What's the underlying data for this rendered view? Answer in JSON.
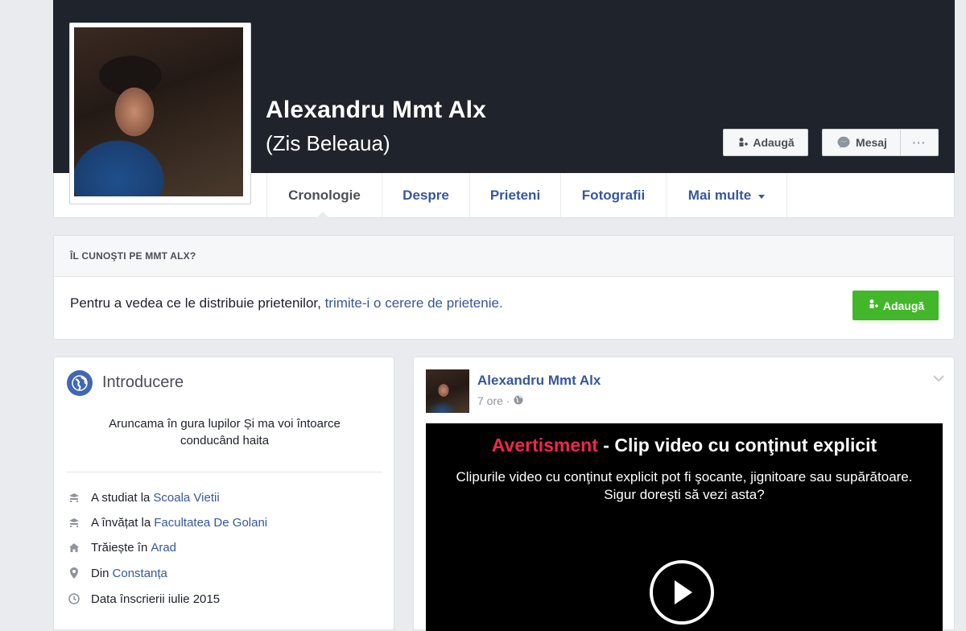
{
  "profile": {
    "name": "Alexandru Mmt Alx",
    "alt_name": "(Zis Beleaua)"
  },
  "header_buttons": {
    "add_friend": "Adaugă",
    "message": "Mesaj",
    "more": "···"
  },
  "tabs": [
    {
      "label": "Cronologie",
      "active": true
    },
    {
      "label": "Despre"
    },
    {
      "label": "Prieteni"
    },
    {
      "label": "Fotografii"
    },
    {
      "label": "Mai multe"
    }
  ],
  "know_card": {
    "title": "ÎL CUNOŞTI PE MMT ALX?",
    "text": "Pentru a vedea ce le distribuie prietenilor, ",
    "link": "trimite-i o cerere de prietenie.",
    "button": "Adaugă"
  },
  "intro": {
    "title": "Introducere",
    "bio": "Aruncama în gura lupilor Și ma voi întoarce conducând haita",
    "rows": [
      {
        "icon": "school-icon",
        "text": "A studiat la",
        "link": "Scoala Vietii"
      },
      {
        "icon": "school-icon",
        "text": "A învățat la",
        "link": "Facultatea De Golani"
      },
      {
        "icon": "home-icon",
        "text": "Trăiește în",
        "link": "Arad"
      },
      {
        "icon": "location-pin-icon",
        "text": "Din",
        "link": "Constanța"
      },
      {
        "icon": "clock-icon",
        "text": "Data înscrierii iulie 2015",
        "link": ""
      }
    ]
  },
  "post": {
    "author": "Alexandru Mmt Alx",
    "time": "7 ore",
    "separator": "·",
    "warning_label": "Avertisment",
    "warning_title": " - Clip video cu conţinut explicit",
    "warning_line1": "Clipurile video cu conţinut explicit pot fi şocante, jignitoare sau supărătoare.",
    "warning_line2": "Sigur doreşti să vezi asta?"
  },
  "colors": {
    "cover": "#1f232b",
    "link": "#365899",
    "green": "#42b72a",
    "warning_red": "#f02849"
  }
}
